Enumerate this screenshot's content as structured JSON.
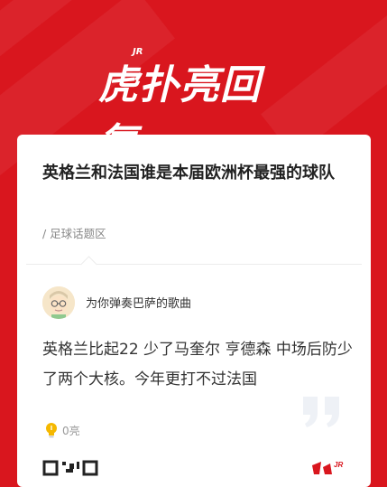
{
  "app": {
    "logo_text": "虎扑亮回复",
    "logo_badge": "JR"
  },
  "post": {
    "title": "英格兰和法国谁是本届欧洲杯最强的球队",
    "topic": "/ 足球话题区"
  },
  "reply": {
    "username": "为你弹奏巴萨的歌曲",
    "content": "英格兰比起22 少了马奎尔 亨德森 中场后防少了两个大核。今年更打不过法国",
    "likes": "0亮"
  },
  "colors": {
    "brand_red": "#d9161e",
    "like_bulb": "#f5b800"
  }
}
